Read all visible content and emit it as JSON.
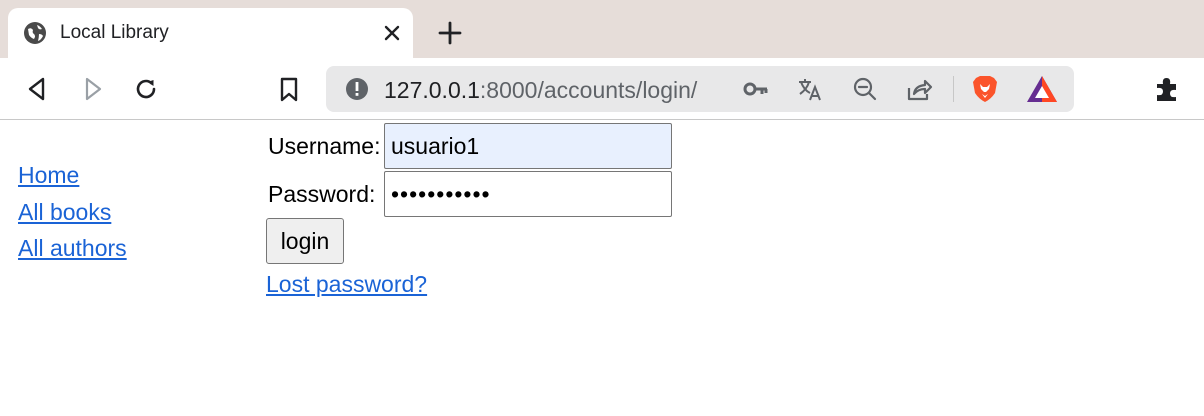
{
  "browser": {
    "tab": {
      "title": "Local Library",
      "favicon": "globe-icon",
      "close_icon": "close-icon"
    },
    "new_tab_icon": "plus-icon",
    "toolbar": {
      "back_icon": "back-icon",
      "forward_icon": "forward-icon",
      "reload_icon": "reload-icon",
      "bookmark_icon": "bookmark-icon",
      "extensions_icon": "puzzle-icon"
    },
    "omnibox": {
      "url_host": "127.0.0.1",
      "url_rest": ":8000/accounts/login/",
      "info_icon": "info-icon",
      "icons": [
        "key-icon",
        "translate-icon",
        "zoom-out-icon",
        "share-icon",
        "brave-lion-icon",
        "brave-rewards-icon"
      ]
    }
  },
  "sidebar": {
    "items": [
      {
        "label": "Home"
      },
      {
        "label": "All books"
      },
      {
        "label": "All authors"
      }
    ]
  },
  "login_form": {
    "username_label": "Username:",
    "username_value": "usuario1",
    "password_label": "Password:",
    "password_value": "•••••••••••",
    "submit_label": "login",
    "lost_password_label": "Lost password?"
  },
  "colors": {
    "link": "#1a63d6",
    "tabstrip": "#e6ddd9",
    "omnibox": "#e8e8e9",
    "autofill": "#e8f0fe"
  }
}
